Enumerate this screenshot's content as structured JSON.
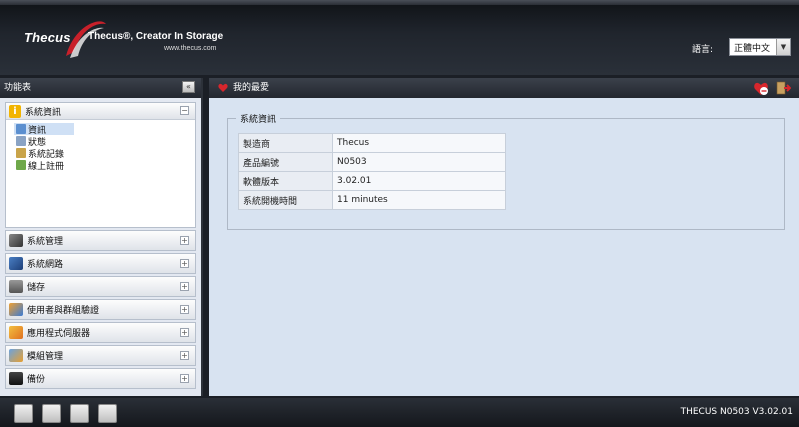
{
  "header": {
    "logo_text": "Thecus",
    "tagline": "Thecus®, Creator In Storage",
    "website": "www.thecus.com",
    "language_label": "語言:",
    "language_value": "正體中文"
  },
  "sidebar": {
    "title": "功能表",
    "collapse_icon": "double-chevron-left-icon",
    "open_section": {
      "label": "系統資訊",
      "items": [
        {
          "label": "資訊",
          "icon": "info-document-icon",
          "active": true
        },
        {
          "label": "狀態",
          "icon": "status-icon",
          "active": false
        },
        {
          "label": "系統記錄",
          "icon": "log-icon",
          "active": false
        },
        {
          "label": "線上註冊",
          "icon": "register-icon",
          "active": false
        }
      ]
    },
    "sections": [
      {
        "label": "系統管理",
        "icon": "tools-icon"
      },
      {
        "label": "系統網路",
        "icon": "network-icon"
      },
      {
        "label": "儲存",
        "icon": "storage-icon"
      },
      {
        "label": "使用者與群組驗證",
        "icon": "users-icon"
      },
      {
        "label": "應用程式伺服器",
        "icon": "app-server-icon"
      },
      {
        "label": "模組管理",
        "icon": "module-icon"
      },
      {
        "label": "備份",
        "icon": "backup-icon"
      }
    ]
  },
  "main": {
    "title": "我的最愛",
    "fieldset_label": "系統資訊",
    "rows": [
      {
        "key": "製造商",
        "value": "Thecus"
      },
      {
        "key": "產品編號",
        "value": "N0503"
      },
      {
        "key": "軟體版本",
        "value": "3.02.01"
      },
      {
        "key": "系統開機時間",
        "value": "11 minutes"
      }
    ]
  },
  "footer": {
    "version": "THECUS N0503 V3.02.01"
  },
  "colors": {
    "header_bg": "#20252d",
    "sidebar_bg": "#e3e8f1",
    "main_bg": "#d8e3f1",
    "accent_red": "#d7262c"
  }
}
